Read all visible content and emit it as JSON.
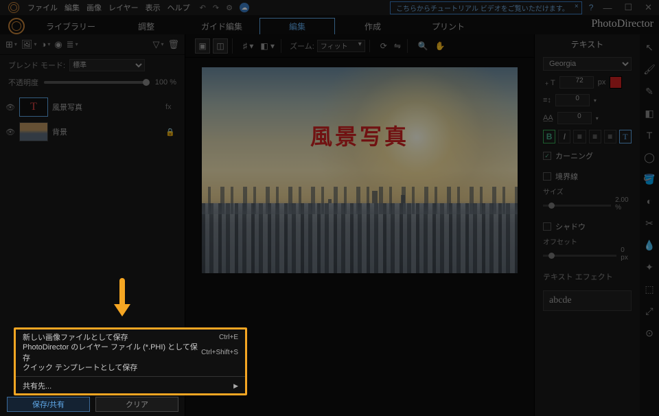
{
  "titlebar": {
    "menus": [
      "ファイル",
      "編集",
      "画像",
      "レイヤー",
      "表示",
      "ヘルプ"
    ],
    "tutorial_banner": "こちらからチュートリアル ビデオをご覧いただけます。"
  },
  "brand": "PhotoDirector",
  "modetabs": {
    "items": [
      "ライブラリー",
      "調整",
      "ガイド編集",
      "編集",
      "作成",
      "プリント"
    ],
    "active_index": 3
  },
  "left": {
    "blend_label": "ブレンド モード:",
    "blend_value": "標準",
    "opacity_label": "不透明度",
    "opacity_value": "100 %",
    "layers": [
      {
        "name": "風景写真",
        "thumb_text": "T",
        "selected": true,
        "right_icon": "fx"
      },
      {
        "name": "背景",
        "thumb_text": "",
        "selected": false,
        "right_icon": "🔒"
      }
    ],
    "bottom_primary": "保存/共有",
    "bottom_secondary": "クリア"
  },
  "center": {
    "zoom_label": "ズーム:",
    "zoom_value": "フィット",
    "canvas_text": "風景写真"
  },
  "right": {
    "title": "テキスト",
    "font": "Georgia",
    "font_size": "72",
    "size_unit": "px",
    "tracking": "0",
    "leading": "0",
    "kerning_label": "カーニング",
    "border_label": "境界線",
    "size_label": "サイズ",
    "size_value": "2.00 %",
    "shadow_label": "シャドウ",
    "offset_label": "オフセット",
    "offset_value": "0 px",
    "effect_label": "テキスト エフェクト",
    "preview_text": "abcde"
  },
  "context_menu": {
    "items": [
      {
        "label": "新しい画像ファイルとして保存",
        "shortcut": "Ctrl+E"
      },
      {
        "label": "PhotoDirector のレイヤー ファイル (*.PHI) として保存",
        "shortcut": "Ctrl+Shift+S"
      },
      {
        "label": "クイック テンプレートとして保存",
        "shortcut": ""
      }
    ],
    "share_label": "共有先..."
  },
  "chart_data": null
}
